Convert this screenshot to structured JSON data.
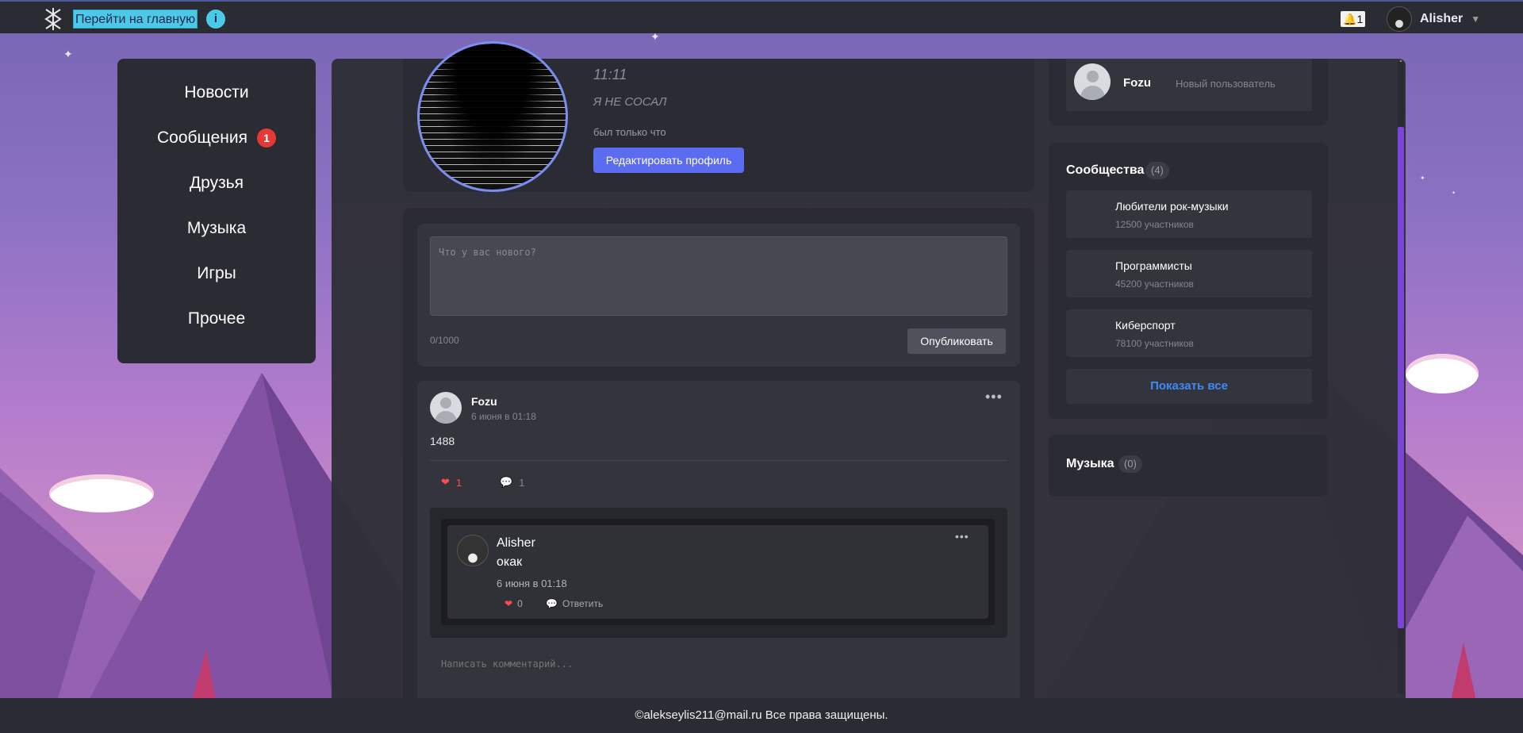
{
  "topbar": {
    "home_link": "Перейти на главную",
    "info": "i",
    "notifications_count": "1",
    "user_name": "Alisher"
  },
  "nav": {
    "items": [
      {
        "label": "Новости"
      },
      {
        "label": "Сообщения",
        "badge": "1"
      },
      {
        "label": "Друзья"
      },
      {
        "label": "Музыка"
      },
      {
        "label": "Игры"
      },
      {
        "label": "Прочее"
      }
    ]
  },
  "profile": {
    "time": "11:11",
    "status": "Я НЕ СОСАЛ",
    "last_seen": "был только что",
    "edit_button": "Редактировать профиль"
  },
  "composer": {
    "placeholder": "Что у вас нового?",
    "counter": "0/1000",
    "publish_button": "Опубликовать"
  },
  "post": {
    "author": "Fozu",
    "date": "6 июня в 01:18",
    "text": "1488",
    "likes": "1",
    "comments": "1",
    "reply": {
      "author": "Alisher",
      "text": "окак",
      "date": "6 июня в 01:18",
      "likes": "0",
      "answer_label": "Ответить"
    },
    "comment_placeholder": "Написать комментарий..."
  },
  "sidebar": {
    "friend": {
      "name": "Fozu",
      "role": "Новый пользователь"
    },
    "communities": {
      "title": "Сообщества",
      "count": "(4)",
      "items": [
        {
          "name": "Любители рок-музыки",
          "members": "12500 участников"
        },
        {
          "name": "Программисты",
          "members": "45200 участников"
        },
        {
          "name": "Киберспорт",
          "members": "78100 участников"
        }
      ],
      "show_all": "Показать все"
    },
    "music": {
      "title": "Музыка",
      "count": "(0)"
    }
  },
  "footer": {
    "text": "©alekseylis211@mail.ru Все права защищены."
  },
  "colors": {
    "accent": "#5b6cf0",
    "link": "#3d8af7",
    "badge": "#e53935",
    "like": "#ff4a4a",
    "scrollbar": "#7b45d8"
  }
}
